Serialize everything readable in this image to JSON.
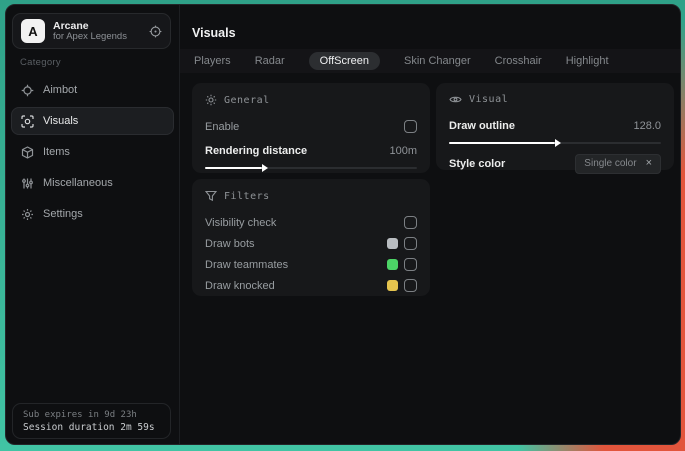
{
  "brand": {
    "logo_letter": "A",
    "name": "Arcane",
    "subtitle": "for Apex Legends"
  },
  "sidebar": {
    "category_label": "Category",
    "items": [
      {
        "label": "Aimbot",
        "icon": "crosshair-icon"
      },
      {
        "label": "Visuals",
        "icon": "scan-eye-icon"
      },
      {
        "label": "Items",
        "icon": "box-icon"
      },
      {
        "label": "Miscellaneous",
        "icon": "sliders-icon"
      },
      {
        "label": "Settings",
        "icon": "gear-icon"
      }
    ],
    "active_item": "Visuals",
    "footer": {
      "line1": "Sub expires in 9d 23h",
      "line2": "Session duration 2m 59s"
    }
  },
  "header": {
    "title": "Visuals"
  },
  "tabs": {
    "active": "OffScreen",
    "items": [
      {
        "label": "Players"
      },
      {
        "label": "Radar"
      },
      {
        "label": "OffScreen"
      },
      {
        "label": "Skin Changer"
      },
      {
        "label": "Crosshair"
      },
      {
        "label": "Highlight"
      }
    ]
  },
  "panels": {
    "general": {
      "title": "General",
      "icon": "sun-icon",
      "enable_label": "Enable",
      "enable_checked": false,
      "rendering": {
        "label": "Rendering distance",
        "value": "100m",
        "fill_style": "width:27%"
      }
    },
    "filters": {
      "title": "Filters",
      "icon": "funnel-icon",
      "rows": [
        {
          "label": "Visibility check",
          "checked": false
        },
        {
          "label": "Draw bots",
          "swatch_color": "#b9bdc1",
          "swatch_style": "background:#b9bdc1",
          "checked": false
        },
        {
          "label": "Draw teammates",
          "swatch_color": "#4cd466",
          "swatch_style": "background:#4cd466",
          "checked": false
        },
        {
          "label": "Draw knocked",
          "swatch_color": "#e5c44e",
          "swatch_style": "background:#e5c44e",
          "checked": false
        }
      ]
    },
    "visual": {
      "title": "Visual",
      "icon": "eye-icon",
      "outline": {
        "label": "Draw outline",
        "value": "128.0",
        "fill_style": "width:50%"
      },
      "style_color": {
        "label": "Style color",
        "chip_label": "Single color",
        "chip_close": "×"
      }
    }
  },
  "colors": {
    "backdrop_teal": "#3ab695",
    "backdrop_red": "#e2553c",
    "swatch_gray": "#b9bdc1",
    "swatch_green": "#4cd466",
    "swatch_yellow": "#e5c44e",
    "panel_bg": "#17181a",
    "window_bg": "#0e0f11"
  }
}
